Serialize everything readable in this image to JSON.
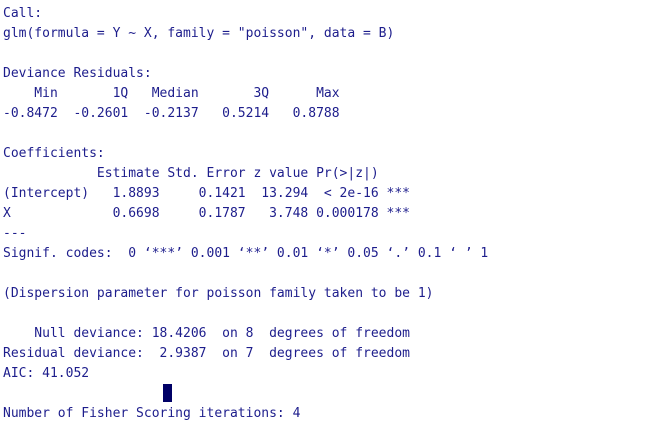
{
  "console": {
    "lines": [
      "Call:",
      "glm(formula = Y ~ X, family = \"poisson\", data = B)",
      "",
      "Deviance Residuals:",
      "    Min       1Q   Median       3Q      Max",
      "-0.8472  -0.2601  -0.2137   0.5214   0.8788",
      "",
      "Coefficients:",
      "            Estimate Std. Error z value Pr(>|z|)",
      "(Intercept)   1.8893     0.1421  13.294  < 2e-16 ***",
      "X             0.6698     0.1787   3.748 0.000178 ***",
      "---",
      "Signif. codes:  0 ‘***’ 0.001 ‘**’ 0.01 ‘*’ 0.05 ‘.’ 0.1 ‘ ’ 1",
      "",
      "(Dispersion parameter for poisson family taken to be 1)",
      "",
      "    Null deviance: 18.4206  on 8  degrees of freedom",
      "Residual deviance:  2.9387  on 7  degrees of freedom",
      "AIC: 41.052",
      "",
      "Number of Fisher Scoring iterations: 4"
    ]
  },
  "colors": {
    "text": "#1d1d8c",
    "background": "#ffffff",
    "cursor": "#000066"
  }
}
